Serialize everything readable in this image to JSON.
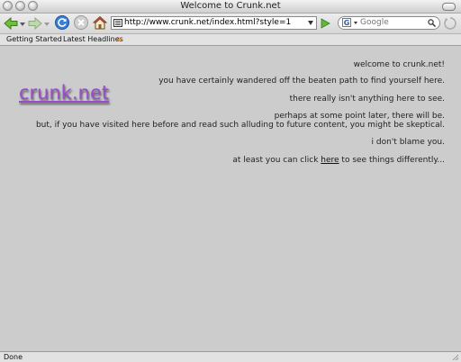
{
  "window": {
    "title": "Welcome to Crunk.net"
  },
  "toolbar": {
    "url": "http://www.crunk.net/index.html?style=1",
    "search_placeholder": "Google",
    "search_engine_letter": "G"
  },
  "bookmarks": {
    "items": [
      "Getting Started",
      "Latest Headlines"
    ]
  },
  "content": {
    "logo": "crunk.net",
    "lines": [
      "welcome to crunk.net!",
      "you have certainly wandered off the beaten path to find yourself here.",
      "there really isn't anything here to see.",
      "perhaps at some point later, there will be.",
      "but, if you have visited here before and read such alluding to future content, you might be skeptical.",
      "i don't blame you."
    ],
    "last_line_before": "at least you can click ",
    "last_line_link": "here",
    "last_line_after": " to see things differently..."
  },
  "status": {
    "text": "Done"
  },
  "colors": {
    "content_bg": "#cccccc",
    "logo": "#9a4bd2",
    "chrome_bg": "#e2e2e2"
  },
  "icons": {
    "back": "back-arrow-icon",
    "forward": "forward-arrow-icon",
    "reload": "reload-icon",
    "stop": "stop-icon",
    "home": "home-icon",
    "go": "go-arrow-icon",
    "search": "magnifier-icon",
    "rss": "rss-icon"
  }
}
